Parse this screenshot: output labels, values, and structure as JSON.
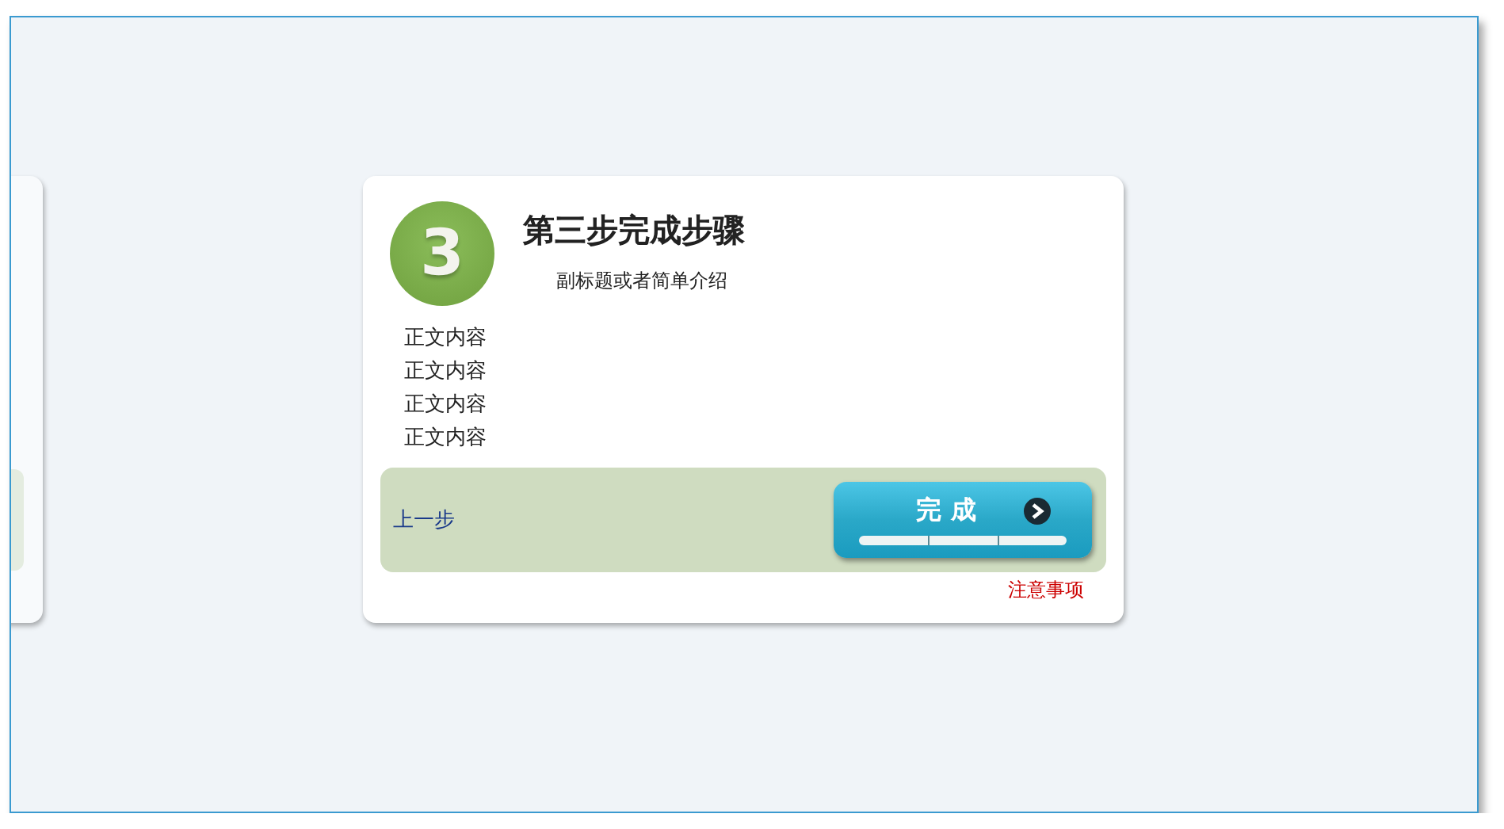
{
  "step": {
    "number": "3",
    "title": "第三步完成步骤",
    "subtitle": "副标题或者简单介绍"
  },
  "body_lines": [
    "正文内容",
    "正文内容",
    "正文内容",
    "正文内容"
  ],
  "footer": {
    "prev_link": "上一步",
    "finish_button": "完 成"
  },
  "notice_link": "注意事项"
}
